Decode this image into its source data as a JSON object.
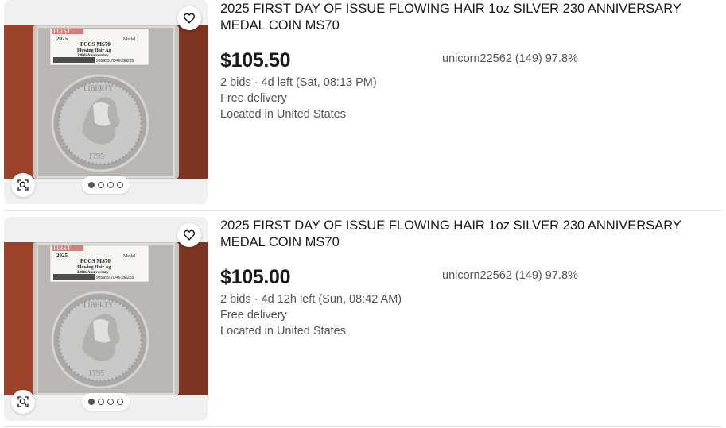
{
  "listings": [
    {
      "title": "2025 FIRST DAY OF ISSUE FLOWING HAIR 1oz SILVER 230 ANNIVERSARY MEDAL COIN MS70",
      "price": "$105.50",
      "bids": "2 bids · 4d left (Sat, 08:13 PM)",
      "delivery": "Free delivery",
      "location": "Located in United States",
      "seller": "unicorn22562 (149) 97.8%",
      "image_slide": 1,
      "image_slide_count": 4,
      "label": {
        "first": "FIRST",
        "year": "2025",
        "medal": "Medal",
        "grade": "PCGS MS70",
        "name": "Flowing Hair Ag",
        "anniv": "230th Anniversary",
        "cert": "935959.70/46788265",
        "legend": "LIBERTY",
        "coin_year": "1795"
      }
    },
    {
      "title": "2025 FIRST DAY OF ISSUE FLOWING HAIR 1oz SILVER 230 ANNIVERSARY MEDAL COIN MS70",
      "price": "$105.00",
      "bids": "2 bids · 4d 12h left (Sun, 08:42 AM)",
      "delivery": "Free delivery",
      "location": "Located in United States",
      "seller": "unicorn22562 (149) 97.8%",
      "image_slide": 1,
      "image_slide_count": 4,
      "label": {
        "first": "FIRST",
        "year": "2025",
        "medal": "Medal",
        "grade": "PCGS MS70",
        "name": "Flowing Hair Ag",
        "anniv": "230th Anniversary",
        "cert": "935959.70/46788265",
        "legend": "LIBERTY",
        "coin_year": "1795"
      }
    }
  ],
  "icons": {
    "watch": "heart-icon",
    "visual_search": "image-search-icon"
  },
  "colors": {
    "text_primary": "#191919",
    "text_secondary": "#555555",
    "divider": "#e5e5e5",
    "image_bg": "#f0f0f0"
  }
}
